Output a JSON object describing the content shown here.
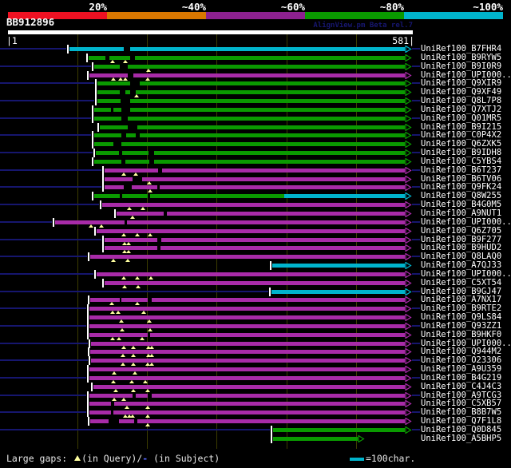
{
  "app": {
    "watermark": "AlignView.pm Beta rel.7"
  },
  "query": {
    "name": "BB912896",
    "start_label": "|1",
    "end_label": "581|"
  },
  "footer": {
    "large_gaps": "Large gaps: ",
    "in_query": "(in Query)/",
    "dash": "-",
    "in_subject": " (in Subject)",
    "scale_note": "=100char."
  },
  "colors": {
    "background": "#000000",
    "green": "#0a9a00",
    "magenta": "#a82ba8",
    "cyan": "#00b4cc",
    "row_baseline_navy": "#16166e",
    "gridline": "#3c3c00",
    "query_gap_triangle": "#ffffa0",
    "footer_dash_blue": "#5566ff",
    "text": "#ffffff"
  },
  "chart_data": {
    "type": "alignment-overview",
    "title": "BB912896",
    "xlim": [
      1,
      581
    ],
    "x_ticks": [
      100,
      200,
      300,
      400,
      500
    ],
    "grid": true,
    "identity_legend": [
      {
        "label": "20%",
        "color": "#ee1122"
      },
      {
        "label": "~40%",
        "color": "#d97700"
      },
      {
        "label": "~60%",
        "color": "#8d2190"
      },
      {
        "label": "~80%",
        "color": "#0a9a00"
      },
      {
        "label": "~100%",
        "color": "#00b4cc"
      }
    ],
    "rows": [
      {
        "label": "UniRef100_B7FHR4",
        "color": "cyan",
        "start": 89,
        "end": 570,
        "gaps": [
          [
            167,
            176
          ]
        ],
        "tris": []
      },
      {
        "label": "UniRef100_B9RYW5",
        "color": "green",
        "start": 116,
        "end": 570,
        "gaps": [
          [
            141,
            146
          ],
          [
            176,
            183
          ]
        ],
        "tris": [
          151,
          169
        ]
      },
      {
        "label": "UniRef100_B9I0R9",
        "color": "green",
        "start": 125,
        "end": 570,
        "gaps": [
          [
            161,
            173
          ]
        ],
        "tris": [
          202
        ]
      },
      {
        "label": "UniRef100_UPI000..",
        "color": "magenta",
        "start": 118,
        "end": 570,
        "gaps": [
          [
            173,
            181
          ]
        ],
        "tris": [
          152,
          162,
          169,
          201
        ]
      },
      {
        "label": "UniRef100_Q9XIR9",
        "color": "green",
        "start": 129,
        "end": 570,
        "gaps": [
          [
            176,
            190
          ]
        ],
        "tris": []
      },
      {
        "label": "UniRef100_Q9XF49",
        "color": "green",
        "start": 129,
        "end": 570,
        "gaps": [
          [
            161,
            169
          ],
          [
            176,
            184
          ]
        ],
        "tris": [
          185
        ]
      },
      {
        "label": "UniRef100_Q8L7P8",
        "color": "green",
        "start": 129,
        "end": 570,
        "gaps": [
          [
            162,
            176
          ]
        ],
        "tris": []
      },
      {
        "label": "UniRef100_Q7XTJ2",
        "color": "green",
        "start": 125,
        "end": 570,
        "gaps": [
          [
            149,
            152
          ],
          [
            163,
            176
          ]
        ],
        "tris": []
      },
      {
        "label": "UniRef100_Q01MR5",
        "color": "green",
        "start": 125,
        "end": 570,
        "gaps": [
          [
            163,
            173
          ]
        ],
        "tris": []
      },
      {
        "label": "UniRef100_B9I215",
        "color": "green",
        "start": 132,
        "end": 570,
        "gaps": [
          [
            173,
            186
          ]
        ],
        "tris": []
      },
      {
        "label": "UniRef100_C0P4X2",
        "color": "green",
        "start": 125,
        "end": 570,
        "gaps": [
          [
            163,
            170
          ],
          [
            184,
            190
          ]
        ],
        "tris": []
      },
      {
        "label": "UniRef100_Q6ZXK5",
        "color": "green",
        "start": 125,
        "end": 570,
        "gaps": [
          [
            152,
            163
          ]
        ],
        "tris": []
      },
      {
        "label": "UniRef100_B9IDH8",
        "color": "green",
        "start": 127,
        "end": 570,
        "gaps": [
          [
            160,
            165
          ],
          [
            202,
            210
          ]
        ],
        "tris": []
      },
      {
        "label": "UniRef100_C5YBS4",
        "color": "green",
        "start": 125,
        "end": 570,
        "gaps": [
          [
            163,
            169
          ],
          [
            203,
            210
          ]
        ],
        "tris": []
      },
      {
        "label": "UniRef100_B6T237",
        "color": "magenta",
        "start": 139,
        "end": 570,
        "gaps": [
          [
            216,
            222
          ]
        ],
        "tris": [
          167,
          184
        ]
      },
      {
        "label": "UniRef100_B6TV06",
        "color": "magenta",
        "start": 139,
        "end": 570,
        "gaps": [
          [
            179,
            193
          ]
        ],
        "tris": [
          203
        ]
      },
      {
        "label": "UniRef100_Q9FK24",
        "color": "magenta",
        "start": 139,
        "end": 570,
        "gaps": [
          [
            167,
            178
          ],
          [
            215,
            218
          ]
        ],
        "tris": [
          205
        ]
      },
      {
        "label": "UniRef100_Q8W255",
        "color": "green",
        "start": 125,
        "end": 570,
        "split": 397,
        "color2": "cyan",
        "gaps": [
          [
            161,
            165
          ],
          [
            201,
            205
          ]
        ],
        "tris": []
      },
      {
        "label": "UniRef100_B4G0M5",
        "color": "magenta",
        "start": 136,
        "end": 570,
        "gaps": [],
        "tris": [
          175,
          194
        ]
      },
      {
        "label": "UniRef100_A9NUT1",
        "color": "magenta",
        "start": 157,
        "end": 570,
        "gaps": [
          [
            224,
            229
          ]
        ],
        "tris": [
          179
        ]
      },
      {
        "label": "UniRef100_UPI000..",
        "color": "magenta",
        "start": 68,
        "end": 570,
        "gaps": [
          [
            168,
            171
          ]
        ],
        "tris": [
          120,
          135
        ]
      },
      {
        "label": "UniRef100_Q6Z705",
        "color": "magenta",
        "start": 128,
        "end": 570,
        "gaps": [],
        "tris": [
          167,
          186,
          205
        ]
      },
      {
        "label": "UniRef100_B9F277",
        "color": "magenta",
        "start": 139,
        "end": 570,
        "gaps": [
          [
            215,
            221
          ]
        ],
        "tris": [
          168,
          174
        ]
      },
      {
        "label": "UniRef100_B9HUD2",
        "color": "magenta",
        "start": 139,
        "end": 570,
        "gaps": [
          [
            215,
            219
          ]
        ],
        "tris": [
          168,
          174
        ]
      },
      {
        "label": "UniRef100_Q8LAQ0",
        "color": "magenta",
        "start": 119,
        "end": 570,
        "gaps": [],
        "tris": [
          152,
          173
        ]
      },
      {
        "label": "UniRef100_A7QJ33",
        "color": "cyan",
        "start": 380,
        "end": 570,
        "gaps": [],
        "tris": []
      },
      {
        "label": "UniRef100_UPI000..",
        "color": "magenta",
        "start": 128,
        "end": 570,
        "gaps": [],
        "tris": [
          167,
          186,
          206
        ]
      },
      {
        "label": "UniRef100_C5XT54",
        "color": "magenta",
        "start": 139,
        "end": 570,
        "gaps": [],
        "tris": [
          168,
          187
        ]
      },
      {
        "label": "UniRef100_B9GJ47",
        "color": "cyan",
        "start": 378,
        "end": 570,
        "gaps": [],
        "tris": []
      },
      {
        "label": "UniRef100_A7NX17",
        "color": "magenta",
        "start": 119,
        "end": 570,
        "gaps": [
          [
            161,
            163
          ],
          [
            201,
            207
          ]
        ],
        "tris": [
          150,
          186
        ]
      },
      {
        "label": "UniRef100_B9RTE2",
        "color": "magenta",
        "start": 118,
        "end": 570,
        "gaps": [],
        "tris": [
          151,
          159,
          195
        ]
      },
      {
        "label": "UniRef100_Q9LS84",
        "color": "magenta",
        "start": 118,
        "end": 570,
        "gaps": [],
        "tris": [
          163,
          203
        ]
      },
      {
        "label": "UniRef100_Q93ZZ1",
        "color": "magenta",
        "start": 118,
        "end": 570,
        "gaps": [],
        "tris": [
          165,
          205
        ]
      },
      {
        "label": "UniRef100_B9HKF0",
        "color": "magenta",
        "start": 118,
        "end": 570,
        "gaps": [
          [
            201,
            205
          ]
        ],
        "tris": [
          151,
          160,
          193
        ]
      },
      {
        "label": "UniRef100_UPI000..",
        "color": "magenta",
        "start": 120,
        "end": 570,
        "gaps": [],
        "tris": [
          167,
          181,
          202,
          207
        ]
      },
      {
        "label": "UniRef100_Q944M2",
        "color": "magenta",
        "start": 119,
        "end": 570,
        "gaps": [],
        "tris": [
          166,
          181,
          202,
          207
        ]
      },
      {
        "label": "UniRef100_O23306",
        "color": "magenta",
        "start": 120,
        "end": 570,
        "gaps": [],
        "tris": [
          166,
          181,
          201,
          207
        ]
      },
      {
        "label": "UniRef100_A9U359",
        "color": "magenta",
        "start": 118,
        "end": 570,
        "gaps": [],
        "tris": [
          153,
          183
        ]
      },
      {
        "label": "UniRef100_B4G219",
        "color": "magenta",
        "start": 118,
        "end": 570,
        "gaps": [],
        "tris": [
          152,
          178,
          198
        ]
      },
      {
        "label": "UniRef100_C4J4C3",
        "color": "magenta",
        "start": 123,
        "end": 570,
        "gaps": [],
        "tris": [
          155,
          181,
          201
        ]
      },
      {
        "label": "UniRef100_A9TCG3",
        "color": "magenta",
        "start": 118,
        "end": 570,
        "gaps": [
          [
            179,
            184
          ],
          [
            201,
            207
          ]
        ],
        "tris": [
          153,
          167
        ]
      },
      {
        "label": "UniRef100_C5XB57",
        "color": "magenta",
        "start": 118,
        "end": 570,
        "gaps": [
          [
            149,
            153
          ]
        ],
        "tris": [
          171,
          201
        ]
      },
      {
        "label": "UniRef100_B8B7W5",
        "color": "magenta",
        "start": 118,
        "end": 570,
        "gaps": [
          [
            149,
            152
          ]
        ],
        "tris": [
          169,
          175,
          179,
          201
        ]
      },
      {
        "label": "UniRef100_Q7F1L8",
        "color": "magenta",
        "start": 119,
        "end": 570,
        "gaps": [
          [
            145,
            160
          ],
          [
            182,
            186
          ]
        ],
        "tris": [
          201
        ]
      },
      {
        "label": "UniRef100_Q0D845",
        "color": "green",
        "start": 381,
        "end": 570,
        "gaps": [],
        "tris": []
      },
      {
        "label": "UniRef100_A5BHP5",
        "color": "green",
        "start": 381,
        "end": 502,
        "gaps": [],
        "tris": []
      }
    ]
  }
}
